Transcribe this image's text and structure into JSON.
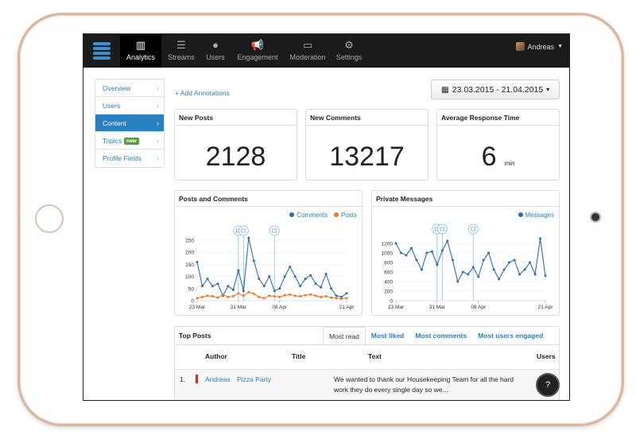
{
  "nav": {
    "items": [
      {
        "label": "Analytics",
        "icon": "bar-chart-icon",
        "glyph": "▥"
      },
      {
        "label": "Streams",
        "icon": "list-icon",
        "glyph": "☰"
      },
      {
        "label": "Users",
        "icon": "user-icon",
        "glyph": "●"
      },
      {
        "label": "Engagement",
        "icon": "megaphone-icon",
        "glyph": "📢"
      },
      {
        "label": "Moderation",
        "icon": "inbox-icon",
        "glyph": "▭"
      },
      {
        "label": "Settings",
        "icon": "gear-icon",
        "glyph": "⚙"
      }
    ],
    "user_name": "Andreas",
    "caret": "▼"
  },
  "sidebar": {
    "items": [
      {
        "label": "Overview"
      },
      {
        "label": "Users"
      },
      {
        "label": "Content"
      },
      {
        "label": "Topics",
        "badge": "new"
      },
      {
        "label": "Profile Fields"
      }
    ],
    "chevron": "›"
  },
  "toolbar": {
    "add_annotations": "+ Add Annotations",
    "date_icon": "▦",
    "date_range": "23.03.2015 - 21.04.2015",
    "date_caret": "▾"
  },
  "stats": {
    "new_posts": {
      "title": "New Posts",
      "value": "2128"
    },
    "new_comments": {
      "title": "New Comments",
      "value": "13217"
    },
    "avg_response": {
      "title": "Average Response Time",
      "value": "6",
      "unit": "min"
    }
  },
  "colors": {
    "blue": "#2a7fc0",
    "series_blue": "#2b6fad",
    "orange": "#f07a2a"
  },
  "chart_data": [
    {
      "type": "line",
      "title": "Posts and Comments",
      "x_tick_labels": [
        "23 Mar",
        "31 Mar",
        "08 Apr",
        "21 Apr"
      ],
      "y_tick_labels": [
        "0",
        "50",
        "100",
        "150",
        "200",
        "250"
      ],
      "ylim": [
        0,
        250
      ],
      "annotation_days": [
        8,
        9,
        15
      ],
      "series": [
        {
          "name": "Comments",
          "color": "#2b6fad",
          "values": [
            160,
            60,
            90,
            60,
            70,
            20,
            60,
            45,
            125,
            40,
            260,
            165,
            90,
            60,
            100,
            40,
            50,
            100,
            140,
            100,
            60,
            90,
            105,
            70,
            55,
            110,
            50,
            20,
            15,
            30
          ]
        },
        {
          "name": "Posts",
          "color": "#f07a2a",
          "values": [
            10,
            15,
            20,
            18,
            12,
            25,
            15,
            18,
            30,
            20,
            35,
            28,
            15,
            10,
            20,
            18,
            15,
            22,
            25,
            20,
            18,
            22,
            25,
            20,
            15,
            18,
            12,
            10,
            8,
            10
          ]
        }
      ]
    },
    {
      "type": "line",
      "title": "Private Messages",
      "x_tick_labels": [
        "23 Mar",
        "31 Mar",
        "08 Apr",
        "21 Apr"
      ],
      "y_tick_labels": [
        "0",
        "200",
        "400",
        "600",
        "800",
        "1000",
        "1200"
      ],
      "ylim": [
        0,
        1300
      ],
      "annotation_days": [
        8,
        9,
        15
      ],
      "series": [
        {
          "name": "Messages",
          "color": "#2b6fad",
          "values": [
            1200,
            1000,
            950,
            1100,
            850,
            650,
            1000,
            1030,
            750,
            1050,
            1250,
            850,
            400,
            600,
            550,
            700,
            500,
            850,
            1000,
            650,
            450,
            650,
            800,
            850,
            550,
            650,
            800,
            550,
            1300,
            520
          ]
        }
      ]
    }
  ],
  "top_posts": {
    "title": "Top Posts",
    "tabs": [
      "Most read",
      "Most liked",
      "Most comments",
      "Most users engaged"
    ],
    "columns": [
      "Author",
      "Title",
      "Text",
      "Users"
    ],
    "rows": [
      {
        "rank": "1.",
        "author": "Andreas",
        "title": "Pizza Party",
        "text_line1": "We wanted to thank our Housekeeping Team for all the hard",
        "text_line2": "work they do every single day so we..."
      }
    ]
  },
  "help": {
    "glyph": "?"
  }
}
